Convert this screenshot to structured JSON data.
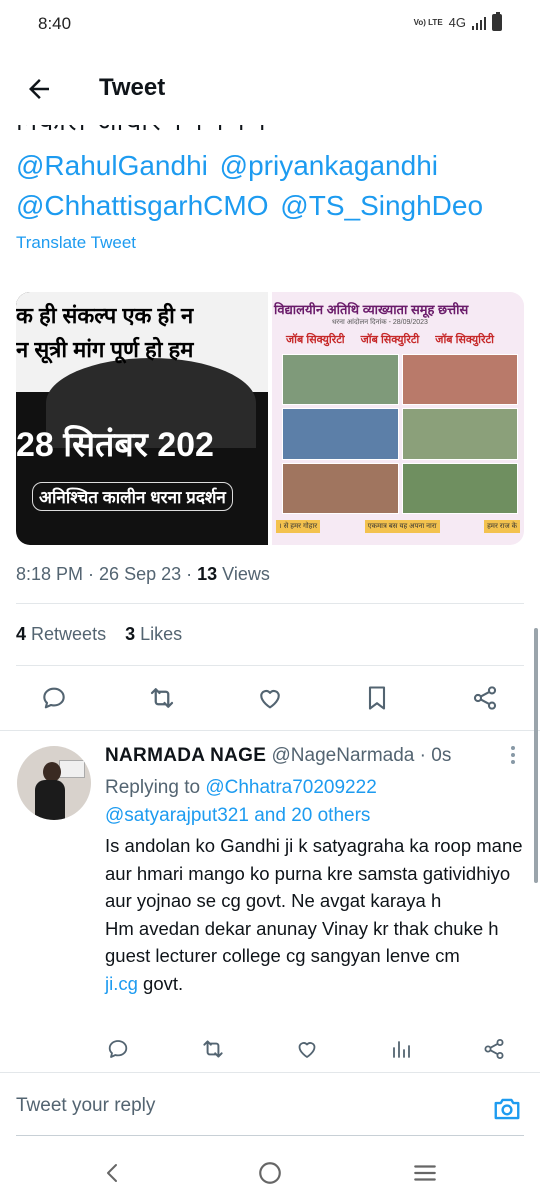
{
  "status_bar": {
    "time": "8:40",
    "volte": "Vo) LTE",
    "network": "4G"
  },
  "header": {
    "title": "Tweet"
  },
  "tweet": {
    "cutoff_text": "निकाल आधार । । । । ।",
    "mentions": [
      "@RahulGandhi",
      "@priyankagandhi",
      "@ChhattisgarhCMO",
      "@TS_SinghDeo"
    ],
    "translate_label": "Translate Tweet",
    "media": {
      "left": {
        "line1": "क ही संकल्प एक ही न",
        "line2": "न सूत्री मांग पूर्ण हो हम",
        "date": "28 सितंबर 202",
        "banner": "अनिश्चित कालीन धरना प्रदर्शन"
      },
      "right": {
        "title": "विद्यालयीन अतिथि व्याख्याता समूह छत्तीस",
        "subtitle": "धरना आंदोलन दिनांक - 28/09/2023",
        "jobs": [
          "जॉब सिक्युरिटी",
          "जॉब सिक्युरिटी",
          "जॉब सिक्युरिटी"
        ],
        "bottom": [
          "। से हमर गोहार",
          "एकमात्र बस यह अपना नारा",
          "हमर राज के"
        ]
      }
    },
    "time": "8:18 PM",
    "date": "26 Sep 23",
    "views_count": "13",
    "views_label": "Views",
    "retweets_count": "4",
    "retweets_label": "Retweets",
    "likes_count": "3",
    "likes_label": "Likes"
  },
  "reply": {
    "name": "NARMADA NAGE",
    "handle": "@NageNarmada",
    "time": "0s",
    "replying_label": "Replying to",
    "replying_to": "@Chhatra70209222",
    "replying_to_2": "@satyarajput321",
    "and_others": "and 20 others",
    "text_1": "Is andolan ko Gandhi ji k satyagraha ka roop mane aur hmari mango ko purna kre samsta gatividhiyo aur yojnao se cg govt. Ne avgat karaya h",
    "text_2_pre": "Hm avedan dekar anunay Vinay kr thak chuke h guest lecturer college cg  sangyan lenve cm",
    "text_2_link": "ji.cg",
    "text_2_post": "govt."
  },
  "composer": {
    "placeholder": "Tweet your reply"
  },
  "colors": {
    "accent": "#1d9bf0",
    "text": "#0f1419",
    "muted": "#536471"
  },
  "icons": [
    "back-arrow-icon",
    "reply-icon",
    "retweet-icon",
    "like-icon",
    "bookmark-icon",
    "share-icon",
    "views-icon",
    "camera-icon",
    "more-icon",
    "nav-back-icon",
    "nav-home-icon",
    "nav-menu-icon"
  ]
}
